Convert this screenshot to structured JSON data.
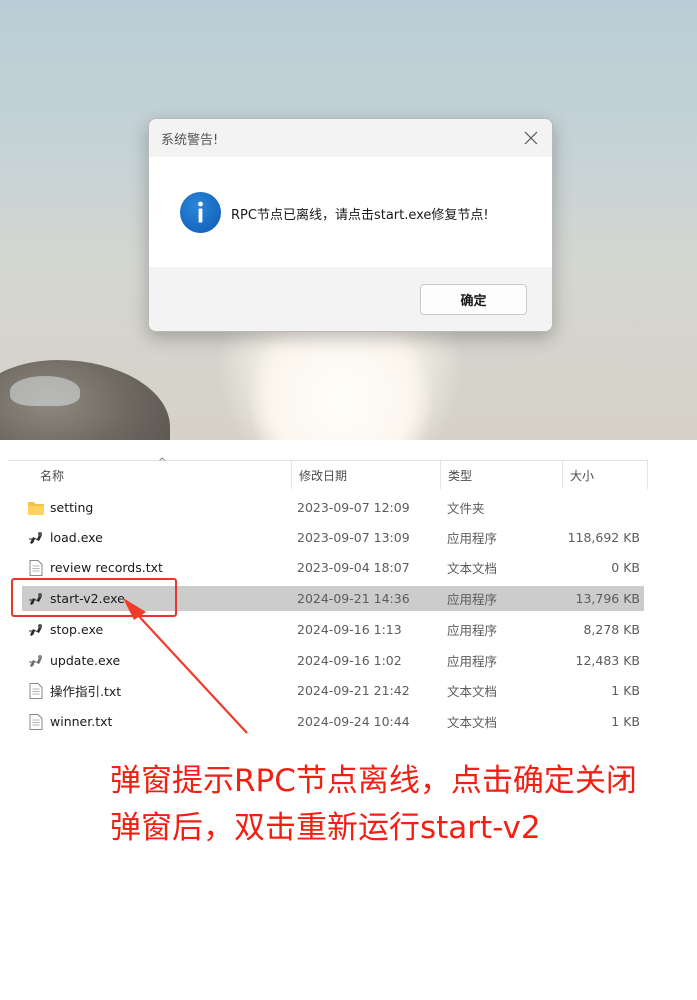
{
  "dialog": {
    "title": "系统警告!",
    "message": "RPC节点已离线，请点击start.exe修复节点!",
    "ok_label": "确定",
    "icons": {
      "info": "info-icon",
      "close": "close-icon"
    }
  },
  "file_list": {
    "columns": {
      "name": "名称",
      "date": "修改日期",
      "type": "类型",
      "size": "大小"
    },
    "rows": [
      {
        "name": "setting",
        "date": "2023-09-07 12:09",
        "type": "文件夹",
        "size": "",
        "icon": "folder-icon"
      },
      {
        "name": "load.exe",
        "date": "2023-09-07 13:09",
        "type": "应用程序",
        "size": "118,692 KB",
        "icon": "exe-icon"
      },
      {
        "name": "review records.txt",
        "date": "2023-09-04 18:07",
        "type": "文本文档",
        "size": "0 KB",
        "icon": "text-file-icon"
      },
      {
        "name": "start-v2.exe",
        "date": "2024-09-21 14:36",
        "type": "应用程序",
        "size": "13,796 KB",
        "icon": "exe-icon",
        "selected": true
      },
      {
        "name": "stop.exe",
        "date": "2024-09-16 1:13",
        "type": "应用程序",
        "size": "8,278 KB",
        "icon": "exe-icon"
      },
      {
        "name": "update.exe",
        "date": "2024-09-16 1:02",
        "type": "应用程序",
        "size": "12,483 KB",
        "icon": "exe-icon"
      },
      {
        "name": "操作指引.txt",
        "date": "2024-09-21 21:42",
        "type": "文本文档",
        "size": "1 KB",
        "icon": "text-file-icon"
      },
      {
        "name": "winner.txt",
        "date": "2024-09-24 10:44",
        "type": "文本文档",
        "size": "1 KB",
        "icon": "text-file-icon"
      }
    ]
  },
  "annotation": {
    "line1": "弹窗提示RPC节点离线，点击确定关闭",
    "line2": "弹窗后，双击重新运行start-v2",
    "color": "#f21f12"
  }
}
